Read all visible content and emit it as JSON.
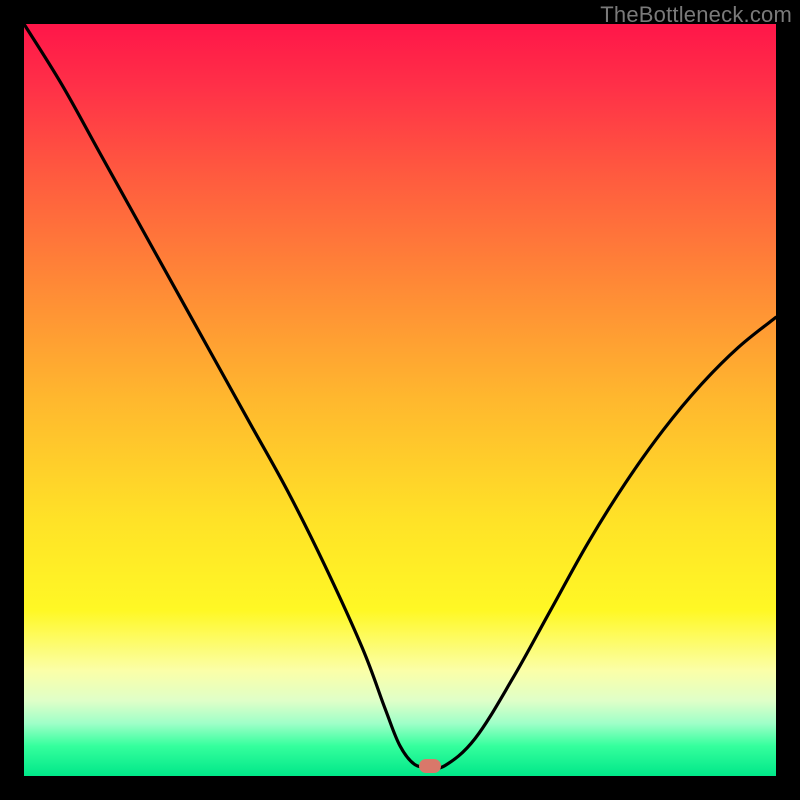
{
  "watermark": "TheBottleneck.com",
  "marker": {
    "cx_pct": 54.0,
    "cy_pct": 98.6
  },
  "chart_data": {
    "type": "line",
    "title": "",
    "xlabel": "",
    "ylabel": "",
    "xlim": [
      0,
      100
    ],
    "ylim": [
      0,
      100
    ],
    "series": [
      {
        "name": "curve",
        "x": [
          0,
          5,
          10,
          15,
          20,
          25,
          30,
          35,
          40,
          45,
          48,
          50,
          52,
          54,
          56,
          60,
          65,
          70,
          75,
          80,
          85,
          90,
          95,
          100
        ],
        "y": [
          100,
          92,
          83,
          74,
          65,
          56,
          47,
          38,
          28,
          17,
          9,
          4,
          1.5,
          1.3,
          1.4,
          5,
          13,
          22,
          31,
          39,
          46,
          52,
          57,
          61
        ]
      }
    ],
    "gradient_stops": [
      {
        "pct": 0,
        "color": "#ff1649"
      },
      {
        "pct": 8,
        "color": "#ff2f48"
      },
      {
        "pct": 20,
        "color": "#ff5a3f"
      },
      {
        "pct": 35,
        "color": "#ff8a36"
      },
      {
        "pct": 50,
        "color": "#ffb82e"
      },
      {
        "pct": 66,
        "color": "#ffe227"
      },
      {
        "pct": 78,
        "color": "#fff825"
      },
      {
        "pct": 86,
        "color": "#fbffa8"
      },
      {
        "pct": 90,
        "color": "#dfffc8"
      },
      {
        "pct": 93,
        "color": "#9fffc8"
      },
      {
        "pct": 96,
        "color": "#35ff9d"
      },
      {
        "pct": 100,
        "color": "#00e789"
      }
    ],
    "marker": {
      "x": 54,
      "y": 1.3,
      "color": "#d9786a"
    }
  }
}
